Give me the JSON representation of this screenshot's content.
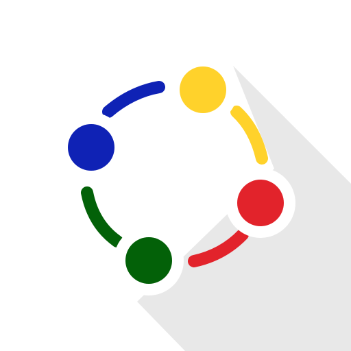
{
  "logo": {
    "icon": "connected-circles-ring-icon",
    "colors": {
      "background": "#ffffff",
      "shadow": "#e8e8e8",
      "halo": "#ffffff",
      "blue": "#0f22b5",
      "yellow": "#ffd22b",
      "red": "#e2232b",
      "green": "#036108"
    }
  }
}
